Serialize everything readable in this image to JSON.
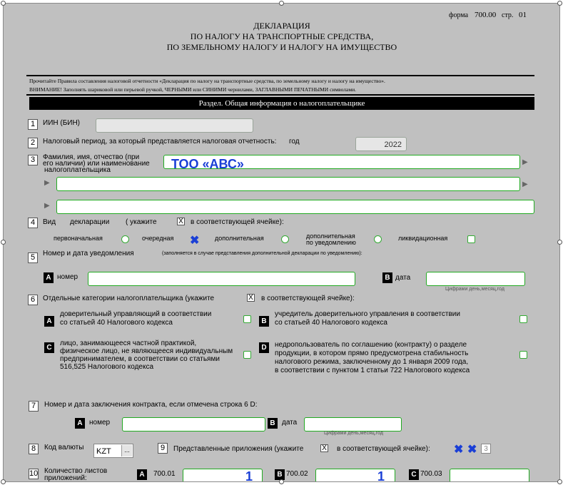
{
  "form_code": "форма",
  "form_number": "700.00",
  "page_label": "стр.",
  "page_number": "01",
  "title_lines": [
    "ДЕКЛАРАЦИЯ",
    "ПО НАЛОГУ НА ТРАНСПОРТНЫЕ СРЕДСТВА,",
    "ПО ЗЕМЕЛЬНОМУ НАЛОГУ И НАЛОГУ НА ИМУЩЕСТВО"
  ],
  "notice1": "Прочитайте Правила составления налоговой отчетности «Декларация по налогу на транспортные средства, по земельному налогу и налогу на имущество».",
  "notice2": "ВНИМАНИЕ! Заполнять шариковой или перьевой ручкой, ЧЕРНЫМИ или СИНИМИ чернилами, ЗАГЛАВНЫМИ ПЕЧАТНЫМИ символами.",
  "section_title": "Раздел. Общая информация о налогоплательщике",
  "rows": {
    "r1": {
      "num": "1",
      "label": "ИИН (БИН)"
    },
    "r2": {
      "num": "2",
      "label": "Налоговый период, за который представляется налоговая отчетность:",
      "year_label": "год",
      "year_value": "2022"
    },
    "r3": {
      "num": "3",
      "label_a": "Фамилия, имя, отчество (при",
      "label_b": "его наличии) или наименование",
      "label_c": "налогоплательщика",
      "value": "ТОО «АВС»"
    },
    "r4": {
      "num": "4",
      "label_a": "Вид",
      "label_b": "декларации",
      "label_c": "( укажите",
      "x": "X",
      "label_d": "в соответствующей ячейке):",
      "options": {
        "initial": "первоначальная",
        "regular": "очередная",
        "additional": "дополнительная",
        "additional_notice_a": "дополнительная",
        "additional_notice_b": "по уведомлению",
        "liquidation": "ликвидационная"
      }
    },
    "r5": {
      "num": "5",
      "label": "Номер и дата уведомления",
      "hint": "(заполняется в случае представления дополнительной декларации по уведомлению):",
      "a_letter": "A",
      "a_label": "номер",
      "b_letter": "B",
      "b_label": "дата",
      "date_hint": "Цифрами день,месяц,год"
    },
    "r6": {
      "num": "6",
      "label": "Отдельные категории налогоплательщика (укажите",
      "x": "X",
      "label_end": "в соответствующей ячейке):",
      "a": {
        "letter": "A",
        "line1": "доверительный управляющий в соответствии",
        "line2": "со статьей 40 Налогового кодекса"
      },
      "b": {
        "letter": "B",
        "line1": "учредитель доверительного управления в соответствии",
        "line2": "со статьей 40 Налогового кодекса"
      },
      "c": {
        "letter": "C",
        "line1": "лицо, занимающееся частной практикой,",
        "line2": "физическое лицо, не являющееся индивидуальным",
        "line3": "предпринимателем, в соответствии со статьями",
        "line4": "516,525 Налогового кодекса"
      },
      "d": {
        "letter": "D",
        "line1": "недропользователь по соглашению (контракту) о разделе",
        "line2": "продукции, в котором прямо предусмотрена стабильность",
        "line3": "налогового режима, заключенному до 1 января 2009 года,",
        "line4": "в соответствии с пунктом 1 статьи 722 Налогового кодекса"
      }
    },
    "r7": {
      "num": "7",
      "label": "Номер и дата заключения контракта, если отмечена строка 6 D:",
      "a_letter": "A",
      "a_label": "номер",
      "b_letter": "B",
      "b_label": "дата",
      "date_hint": "Цифрами день,месяц,год"
    },
    "r8": {
      "num": "8",
      "label": "Код валюты",
      "currency": "KZT",
      "btn": "..."
    },
    "r9": {
      "num": "9",
      "label": "Представленные приложения (укажите",
      "x": "X",
      "label_end": "в соответствующей ячейке):",
      "count": "3"
    },
    "r10": {
      "num": "10",
      "label_a": "Количество листов",
      "label_b": "приложений:",
      "a_letter": "A",
      "a_code": "700.01",
      "a_value": "1",
      "b_letter": "B",
      "b_code": "700.02",
      "b_value": "1",
      "c_letter": "C",
      "c_code": "700.03",
      "c_value": ""
    }
  },
  "colors": {
    "accent": "#1a3fd6",
    "field_border": "#22aa22",
    "background": "#c0c0c0"
  }
}
